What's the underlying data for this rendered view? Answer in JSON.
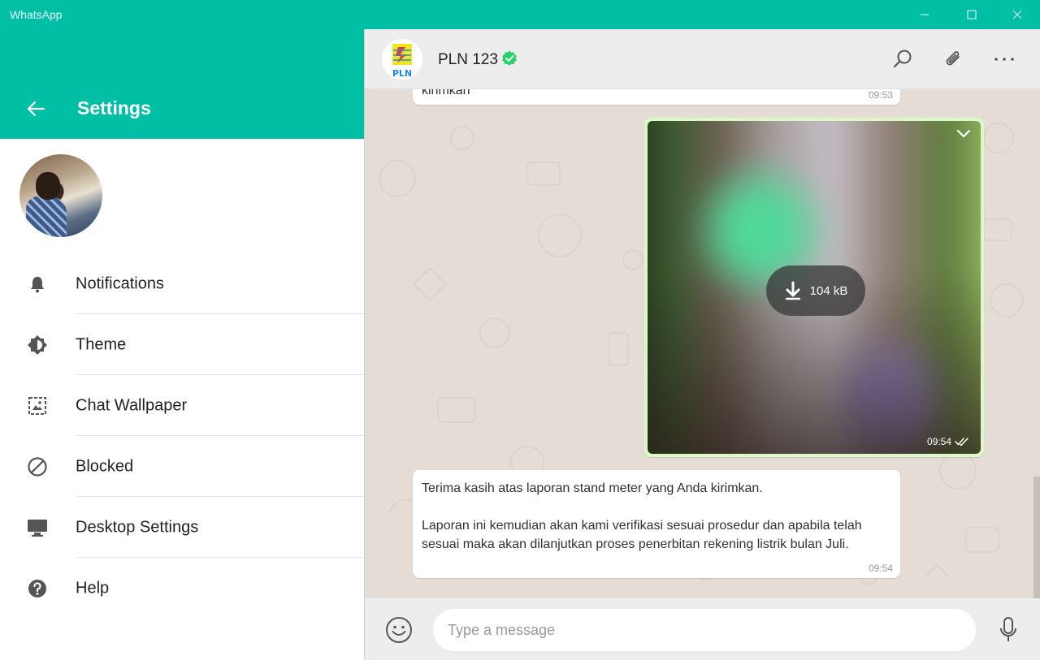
{
  "window": {
    "title": "WhatsApp"
  },
  "settings": {
    "title": "Settings",
    "menu": [
      {
        "label": "Notifications",
        "icon": "bell-icon"
      },
      {
        "label": "Theme",
        "icon": "theme-icon"
      },
      {
        "label": "Chat Wallpaper",
        "icon": "wallpaper-icon"
      },
      {
        "label": "Blocked",
        "icon": "block-icon"
      },
      {
        "label": "Desktop Settings",
        "icon": "monitor-icon"
      },
      {
        "label": "Help",
        "icon": "help-icon"
      }
    ]
  },
  "chat": {
    "contact_name": "PLN 123",
    "contact_logo_text": "PLN",
    "messages": [
      {
        "type": "text",
        "direction": "in",
        "text": "kirimkan",
        "time": "09:53"
      },
      {
        "type": "image",
        "direction": "out",
        "size": "104 kB",
        "time": "09:54",
        "status": "read"
      },
      {
        "type": "text",
        "direction": "in",
        "text": "Terima kasih atas laporan stand meter yang Anda kirimkan.\n\nLaporan ini kemudian akan kami verifikasi sesuai prosedur dan apabila telah sesuai maka akan dilanjutkan proses penerbitan rekening listrik bulan Juli.",
        "time": "09:54"
      }
    ],
    "input_placeholder": "Type a message"
  },
  "colors": {
    "accent": "#00bfa5",
    "chat_bg": "#e5ddd5",
    "outgoing_bubble": "#dcf8c6",
    "verified": "#25d366"
  }
}
